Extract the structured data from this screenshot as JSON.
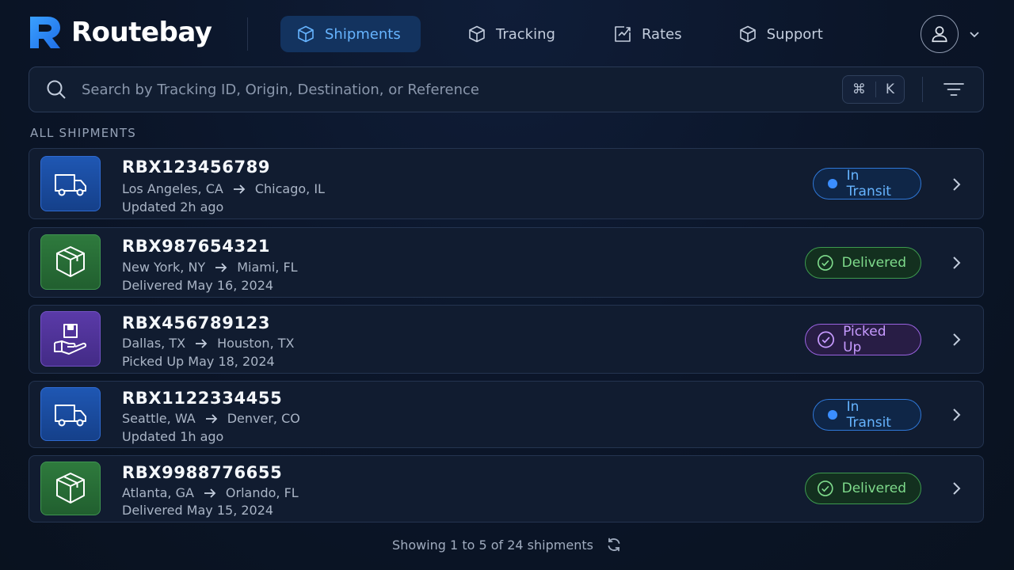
{
  "app": {
    "name": "Routebay",
    "brand_color": "#2f8cff"
  },
  "nav": {
    "items": [
      {
        "label": "Shipments",
        "icon": "box-icon",
        "active": true
      },
      {
        "label": "Tracking",
        "icon": "box-icon",
        "active": false
      },
      {
        "label": "Rates",
        "icon": "chart-icon",
        "active": false
      },
      {
        "label": "Support",
        "icon": "box-icon",
        "active": false
      }
    ]
  },
  "user": {
    "icon": "user-icon"
  },
  "search": {
    "placeholder": "Search by Tracking ID, Origin, Destination, or Reference",
    "value": "",
    "shortcut_mod": "⌘",
    "shortcut_key": "K"
  },
  "section": {
    "title": "ALL SHIPMENTS"
  },
  "shipments": [
    {
      "id": "RBX123456789",
      "origin": "Los Angeles, CA",
      "destination": "Chicago, IL",
      "updated": "Updated 2h ago",
      "status": "In Transit",
      "icon": "truck-icon",
      "status_color": "#66b4ff"
    },
    {
      "id": "RBX987654321",
      "origin": "New York, NY",
      "destination": "Miami, FL",
      "updated": "Delivered May 16, 2024",
      "status": "Delivered",
      "icon": "package-icon",
      "status_color": "#7fdb8c"
    },
    {
      "id": "RBX456789123",
      "origin": "Dallas, TX",
      "destination": "Houston, TX",
      "updated": "Picked Up May 18, 2024",
      "status": "Picked Up",
      "icon": "hand-package-icon",
      "status_color": "#c79bff"
    },
    {
      "id": "RBX1122334455",
      "origin": "Seattle, WA",
      "destination": "Denver, CO",
      "updated": "Updated 1h ago",
      "status": "In Transit",
      "icon": "truck-icon",
      "status_color": "#66b4ff"
    },
    {
      "id": "RBX9988776655",
      "origin": "Atlanta, GA",
      "destination": "Orlando, FL",
      "updated": "Delivered May 15, 2024",
      "status": "Delivered",
      "icon": "package-icon",
      "status_color": "#7fdb8c"
    }
  ],
  "footer": {
    "text": "Showing 1 to 5 of 24 shipments"
  }
}
